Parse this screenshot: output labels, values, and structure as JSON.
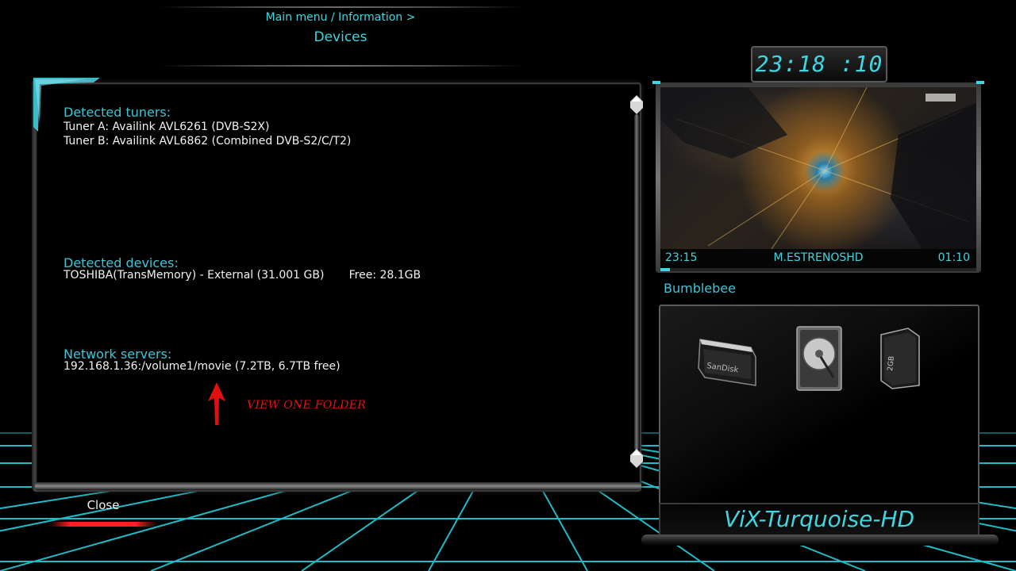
{
  "header": {
    "breadcrumb": "Main menu / Information >",
    "title": "Devices"
  },
  "info": {
    "tuners_heading": "Detected tuners:",
    "tuners": [
      "Tuner A: Availink AVL6261 (DVB-S2X)",
      "Tuner B: Availink AVL6862 (Combined DVB-S2/C/T2)"
    ],
    "devices_heading": "Detected devices:",
    "devices": [
      "TOSHIBA(TransMemory) - External (31.001 GB)       Free: 28.1GB"
    ],
    "network_heading": "Network servers:",
    "network": [
      "192.168.1.36:/volume1/movie (7.2TB, 6.7TB free)"
    ]
  },
  "annotation": {
    "text": "VIEW ONE  FOLDER",
    "color": "#e01010"
  },
  "buttons": {
    "close_label": "Close",
    "close_color": "#ff2020"
  },
  "clock": "23:18 :10",
  "preview": {
    "start_time": "23:15",
    "channel": "M.ESTRENOSHD",
    "end_time": "01:10",
    "progress": 0.03,
    "program": "Bumblebee"
  },
  "device_icons": [
    "ssd-icon",
    "hard-disk-icon",
    "sd-card-icon"
  ],
  "device_icon_labels": {
    "ssd": "SanDisk",
    "sd": "2GB"
  },
  "skin_name": "ViX-Turquoise-HD",
  "colors": {
    "accent": "#3fd6e0",
    "background": "#000000"
  }
}
